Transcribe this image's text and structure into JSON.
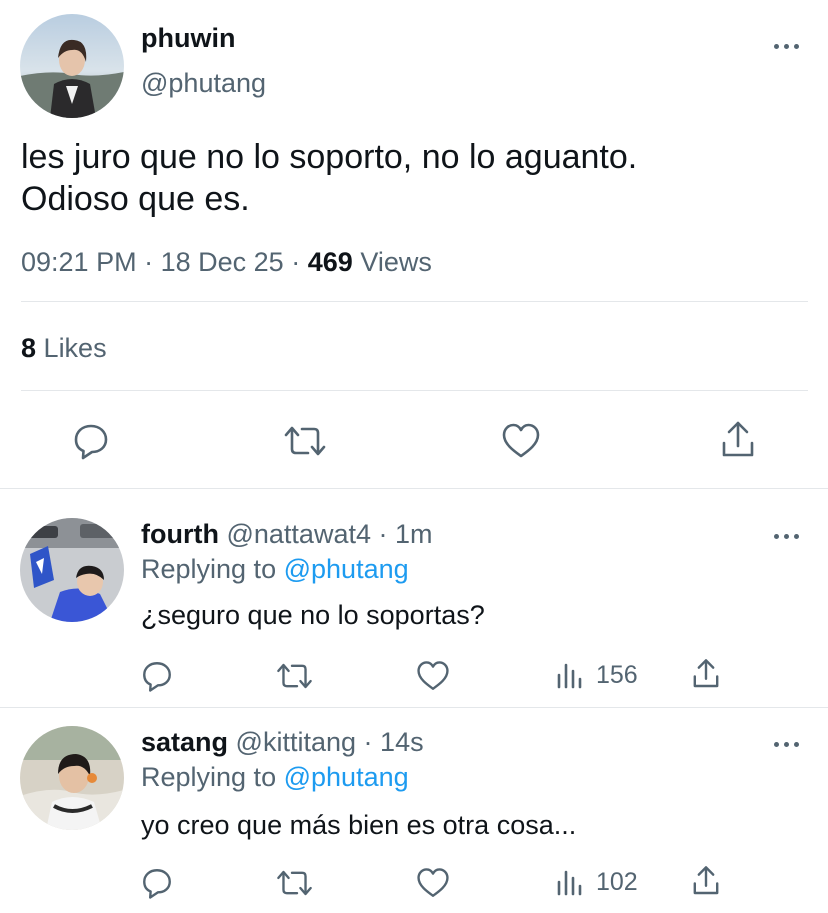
{
  "main_tweet": {
    "name": "phuwin",
    "handle": "@phutang",
    "text_line1": "les juro que no lo soporto, no lo aguanto.",
    "text_line2": "Odioso que es.",
    "time": "09:21 PM",
    "sep1": "·",
    "date": "18 Dec 25",
    "sep2": "·",
    "views_count": "469",
    "views_label": "Views",
    "likes_count": "8",
    "likes_label": "Likes",
    "actions": [
      "reply-icon",
      "retweet-icon",
      "like-icon",
      "share-icon"
    ]
  },
  "replies": [
    {
      "name": "fourth",
      "handle": "@nattawat4",
      "sep": "·",
      "time": "1m",
      "replying_prefix": "Replying to",
      "replying_handle": "@phutang",
      "text": "¿seguro que no lo soportas?",
      "views": "156"
    },
    {
      "name": "satang",
      "handle": "@kittitang",
      "sep": "·",
      "time": "14s",
      "replying_prefix": "Replying to",
      "replying_handle": "@phutang",
      "text": "yo creo que más bien es otra cosa...",
      "views": "102"
    }
  ],
  "colors": {
    "text": "#0f1419",
    "secondary": "#536471",
    "link": "#1d9bf0",
    "divider": "#e4e7ea"
  }
}
